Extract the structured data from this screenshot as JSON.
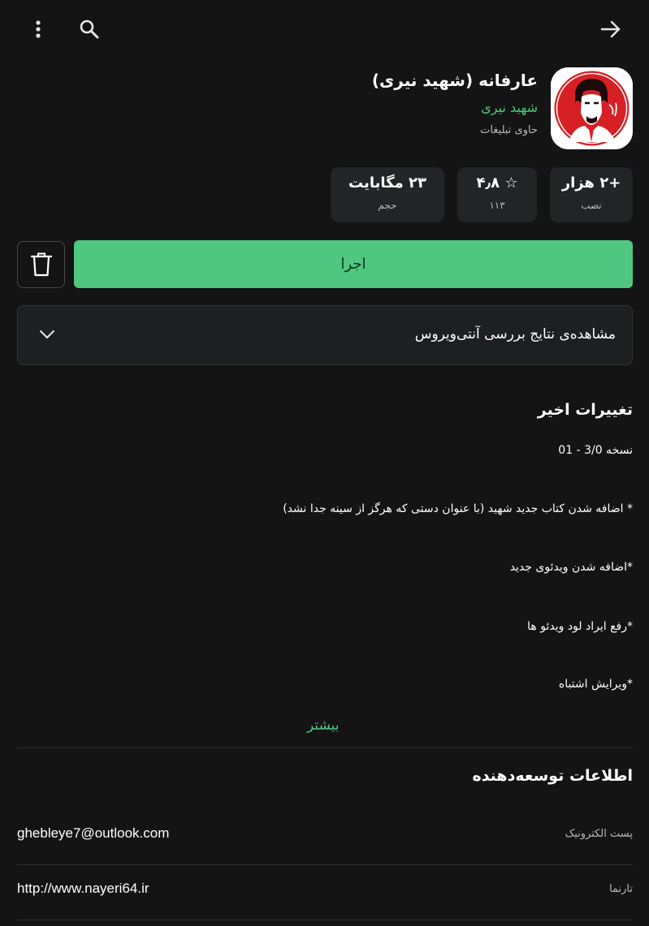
{
  "topbar": {
    "menu_icon": "more-vertical-icon",
    "search_icon": "search-icon",
    "back_icon": "arrow-forward-icon"
  },
  "app": {
    "title": "عارفانه (شهید نیری)",
    "developer": "شهید نیری",
    "ads_note": "حاوی تبلیغات"
  },
  "stats": {
    "installs_value": "+۲ هزار",
    "installs_label": "نصب",
    "rating_value": "۴٫۸",
    "rating_star": "☆",
    "rating_count": "۱۱۳",
    "size_value": "۲۳ مگابایت",
    "size_label": "حجم"
  },
  "actions": {
    "run_label": "اجرا",
    "delete_icon": "trash-icon"
  },
  "antivirus": {
    "label": "مشاهده‌ی نتایج بررسی آنتی‌ویروس"
  },
  "changelog": {
    "title": "تغییرات اخیر",
    "version": "نسخه 3/0 - 01",
    "items": [
      "* اضافه شدن کتاب جدید شهید (با عنوان دستی که هرگز از سینه جدا نشد)",
      "*اضافه شدن ویدئوی جدید",
      "*رفع ایراد لود ویدئو ها",
      "*ویرایش اشتباه"
    ],
    "more_label": "بیشتر"
  },
  "developer_info": {
    "title": "اطلاعات توسعه‌دهنده",
    "email_label": "پست الکترونیک",
    "email": "ghebleye7@outlook.com",
    "website_label": "تارنما",
    "website": "http://www.nayeri64.ir"
  },
  "colors": {
    "background": "#141414",
    "accent": "#4fc780",
    "card": "#232427",
    "icon_red": "#d71f26"
  }
}
